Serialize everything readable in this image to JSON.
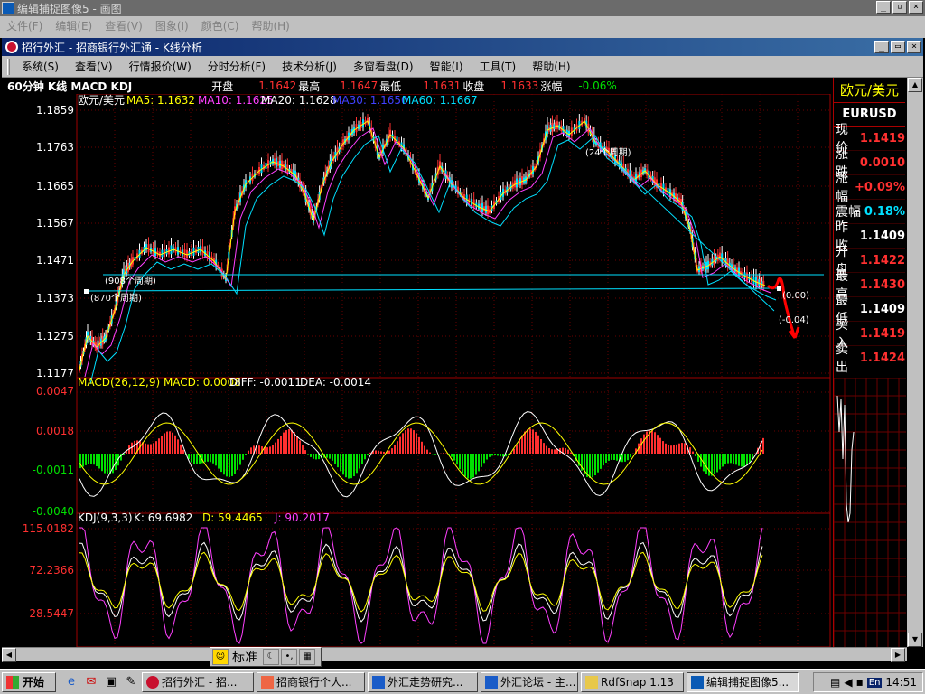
{
  "outer_window": {
    "title": "编辑捕捉图像5 - 画图",
    "menu": [
      "文件(F)",
      "编辑(E)",
      "查看(V)",
      "图象(I)",
      "颜色(C)",
      "帮助(H)"
    ]
  },
  "app_window": {
    "title": "招行外汇 - 招商银行外汇通 - K线分析",
    "menu": [
      "系统(S)",
      "查看(V)",
      "行情报价(W)",
      "分时分析(F)",
      "技术分析(J)",
      "多窗看盘(D)",
      "智能(I)",
      "工具(T)",
      "帮助(H)"
    ]
  },
  "infobar": {
    "period": "60分钟 K线 MACD KDJ",
    "open_label": "开盘",
    "open": "1.1642",
    "high_label": "最高",
    "high": "1.1647",
    "low_label": "最低",
    "low": "1.1631",
    "close_label": "收盘",
    "close": "1.1633",
    "change_label": "涨幅",
    "change": "-0.06%"
  },
  "price_panel": {
    "symbol": "欧元/美元",
    "ma": [
      {
        "label": "MA5: 1.1632",
        "color": "#ffff00"
      },
      {
        "label": "MA10: 1.1625",
        "color": "#ff40ff"
      },
      {
        "label": "MA20: 1.1628",
        "color": "#ffffff"
      },
      {
        "label": "MA30: 1.1650",
        "color": "#4040ff"
      },
      {
        "label": "MA60: 1.1667",
        "color": "#00e0ff"
      }
    ],
    "y_ticks": [
      "1.1859",
      "1.1763",
      "1.1665",
      "1.1567",
      "1.1471",
      "1.1373",
      "1.1275",
      "1.1177"
    ],
    "annotations": [
      "(908个周期)",
      "(870个周期)",
      "(24个周期)",
      "(0.00)",
      "(-0.04)"
    ]
  },
  "macd_panel": {
    "header": "MACD(26,12,9) MACD: 0.0008",
    "diff": "DIFF: -0.0011",
    "dea": "DEA: -0.0014",
    "y_ticks": [
      "0.0047",
      "0.0018",
      "-0.0011",
      "-0.0040"
    ]
  },
  "kdj_panel": {
    "header": "KDJ(9,3,3)",
    "k": "K: 69.6982",
    "d": "D: 59.4465",
    "j": "J: 90.2017",
    "y_ticks": [
      "115.0182",
      "72.2366",
      "28.5447"
    ]
  },
  "quote_panel": {
    "name": "欧元/美元",
    "code": "EURUSD",
    "rows": [
      {
        "label": "现价",
        "value": "1.1419",
        "color": "red"
      },
      {
        "label": "涨跌",
        "value": "0.0010",
        "color": "red"
      },
      {
        "label": "涨幅",
        "value": "+0.09%",
        "color": "red"
      },
      {
        "label": "震幅",
        "value": "0.18%",
        "color": "cyan"
      },
      {
        "label": "昨收",
        "value": "1.1409",
        "color": "white"
      },
      {
        "label": "开盘",
        "value": "1.1422",
        "color": "red"
      },
      {
        "label": "最高",
        "value": "1.1430",
        "color": "red"
      },
      {
        "label": "最低",
        "value": "1.1409",
        "color": "white"
      },
      {
        "label": "买入",
        "value": "1.1419",
        "color": "red"
      },
      {
        "label": "卖出",
        "value": "1.1424",
        "color": "red"
      }
    ]
  },
  "ime_bar": {
    "mode": "标准"
  },
  "taskbar": {
    "start": "开始",
    "tasks": [
      "招行外汇 - 招...",
      "招商银行个人...",
      "外汇走势研究...",
      "外汇论坛 - 主...",
      "RdfSnap 1.13",
      "编辑捕捉图像5..."
    ],
    "active_index": 5,
    "lang": "En",
    "clock": "14:51"
  }
}
